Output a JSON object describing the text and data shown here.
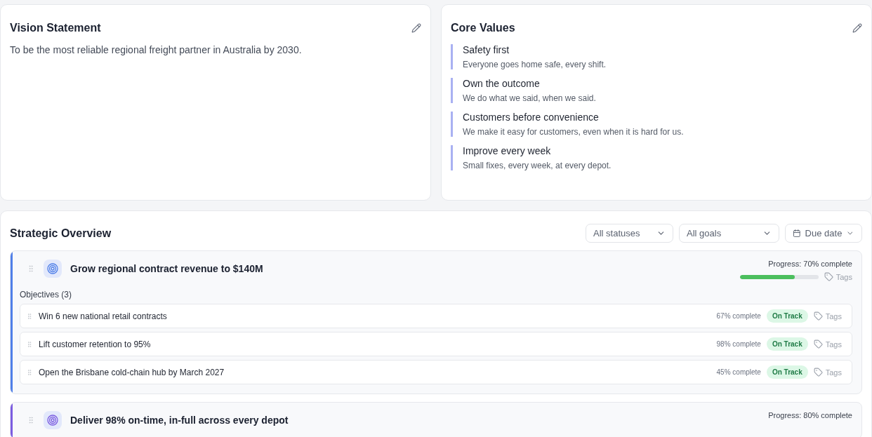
{
  "vision": {
    "title": "Vision Statement",
    "text": "To be the most reliable regional freight partner in Australia by 2030."
  },
  "core_values": {
    "title": "Core Values",
    "items": [
      {
        "name": "Safety first",
        "description": "Everyone goes home safe, every shift."
      },
      {
        "name": "Own the outcome",
        "description": "We do what we said, when we said."
      },
      {
        "name": "Customers before convenience",
        "description": "We make it easy for customers, even when it is hard for us."
      },
      {
        "name": "Improve every week",
        "description": "Small fixes, every week, at every depot."
      }
    ]
  },
  "overview": {
    "title": "Strategic Overview",
    "filters": [
      {
        "kind": "select",
        "label": "All statuses"
      },
      {
        "kind": "select",
        "label": "All goals"
      },
      {
        "kind": "date",
        "label": "Due date"
      }
    ],
    "goals": [
      {
        "title": "Grow regional contract revenue to $140M",
        "color": "#4f7fe8",
        "progress_label": "Progress: 70% complete",
        "level": 0.7,
        "tags_label": "Tags",
        "objectives_label": "Objectives (3)",
        "objectives": [
          {
            "title": "Win 6 new national retail contracts",
            "progress_label": "67% complete",
            "kind": "on_track",
            "status_label": "On Track",
            "tags_label": "Tags"
          },
          {
            "title": "Lift customer retention to 95%",
            "progress_label": "98% complete",
            "kind": "on_track",
            "status_label": "On Track",
            "tags_label": "Tags"
          },
          {
            "title": "Open the Brisbane cold-chain hub by March 2027",
            "progress_label": "45% complete",
            "kind": "on_track",
            "status_label": "On Track",
            "tags_label": "Tags"
          }
        ]
      },
      {
        "title": "Deliver 98% on-time, in-full across every depot",
        "color": "#7b5ce0",
        "progress_label": "Progress: 80% complete"
      }
    ]
  }
}
